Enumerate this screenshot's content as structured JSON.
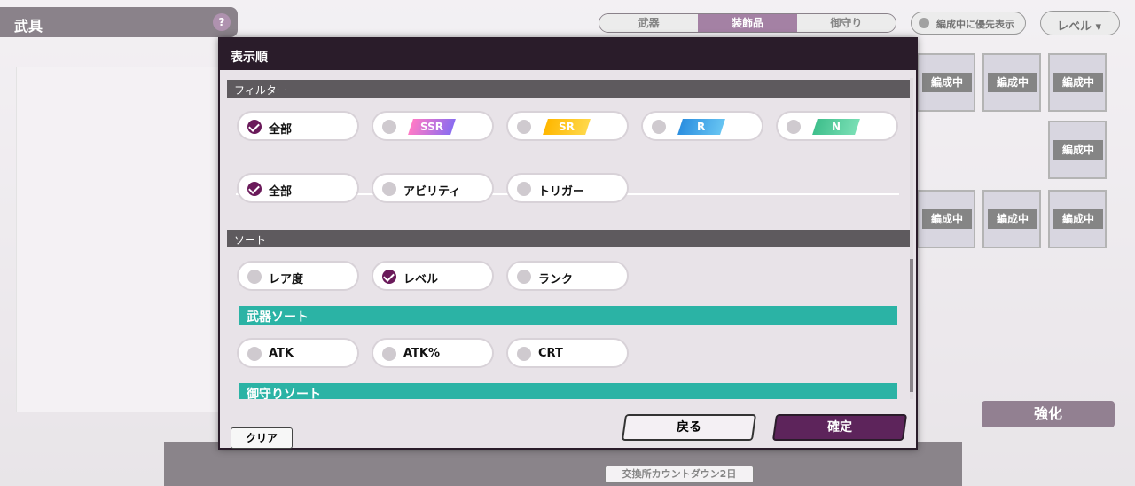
{
  "background": {
    "title": "武具",
    "tabs": [
      "武器",
      "装飾品",
      "御守り"
    ],
    "active_tab": "装飾品",
    "priority_toggle": "編成中に優先表示",
    "level_select": "レベル",
    "grid_badge": "編成中",
    "enhance": "強化",
    "countdown": "交換所カウントダウン2日"
  },
  "dialog": {
    "title": "表示順",
    "filter_section": "フィルター",
    "rarity_options": [
      {
        "label": "全部",
        "checked": true
      },
      {
        "label": "SSR",
        "checked": false,
        "color": "#c05bd6"
      },
      {
        "label": "SR",
        "checked": false,
        "color": "#f0b400"
      },
      {
        "label": "R",
        "checked": false,
        "color": "#3aa6e6"
      },
      {
        "label": "N",
        "checked": false,
        "color": "#4cc89a"
      }
    ],
    "type_options": [
      {
        "label": "全部",
        "checked": true
      },
      {
        "label": "アビリティ",
        "checked": false
      },
      {
        "label": "トリガー",
        "checked": false
      }
    ],
    "sort_section": "ソート",
    "sort_options": [
      {
        "label": "レア度",
        "checked": false
      },
      {
        "label": "レベル",
        "checked": true
      },
      {
        "label": "ランク",
        "checked": false
      }
    ],
    "weapon_sort_title": "武器ソート",
    "weapon_sort_options": [
      {
        "label": "ATK",
        "checked": false
      },
      {
        "label": "ATK%",
        "checked": false
      },
      {
        "label": "CRT",
        "checked": false
      }
    ],
    "amulet_sort_title": "御守りソート",
    "clear_button": "クリア",
    "back_button": "戻る",
    "confirm_button": "確定"
  },
  "colors": {
    "accent_dark": "#2a1c2a",
    "teal": "#2bb3a5",
    "confirm": "#5d245b"
  }
}
